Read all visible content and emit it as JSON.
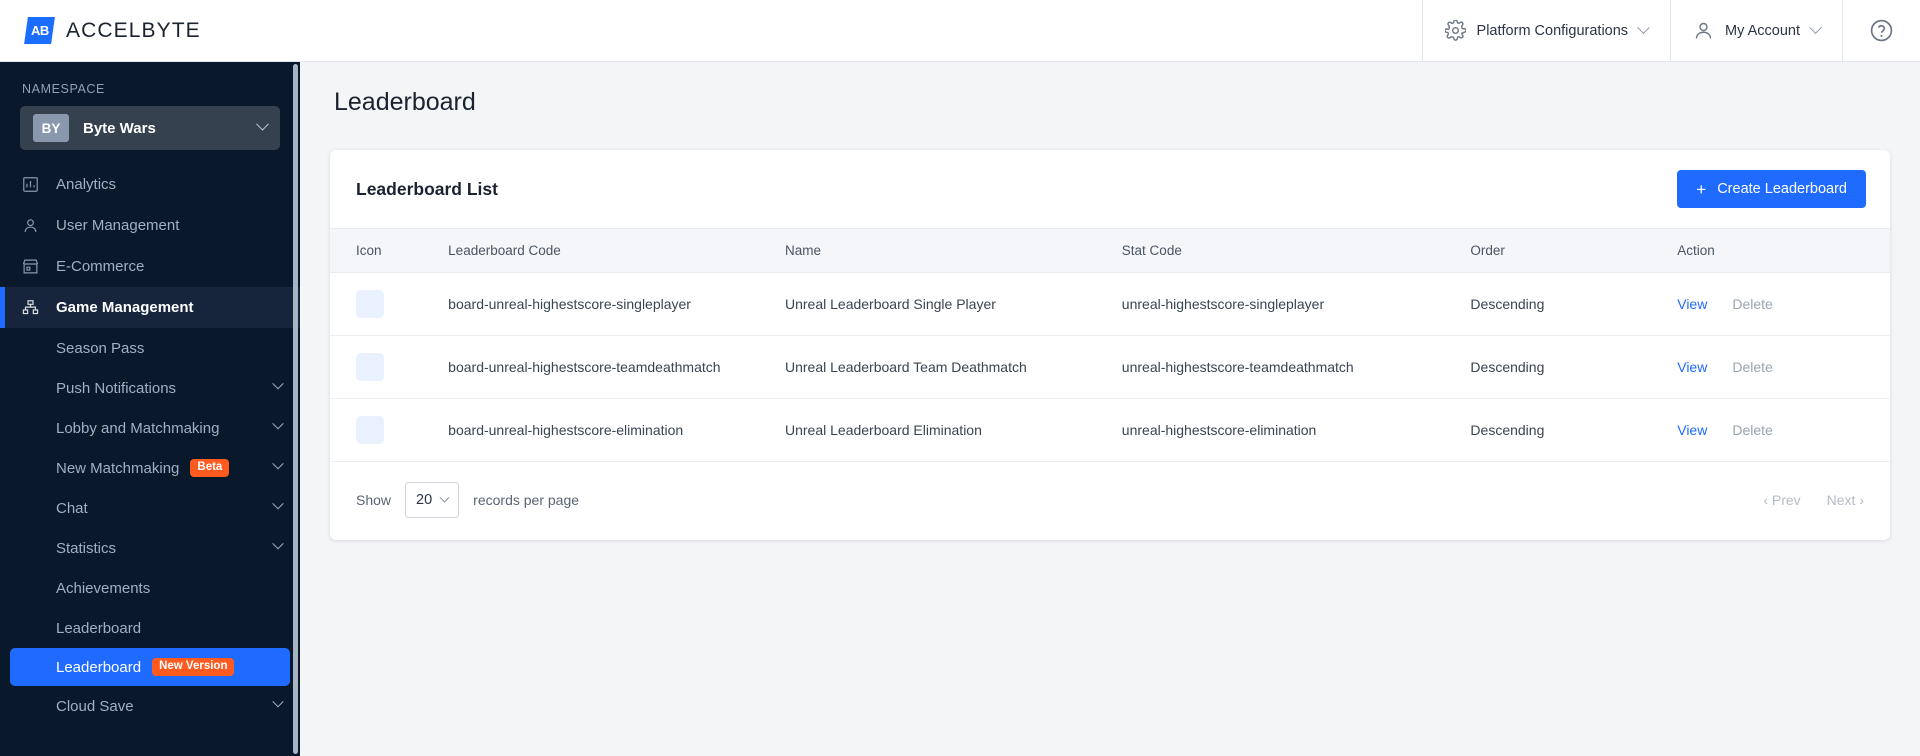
{
  "header": {
    "brand_mark": "AB",
    "brand_name": "ACCELBYTE",
    "platform_config": "Platform Configurations",
    "my_account": "My Account",
    "help": "?"
  },
  "sidebar": {
    "namespace_label": "NAMESPACE",
    "namespace": {
      "badge": "BY",
      "name": "Byte Wars"
    },
    "nav": [
      {
        "label": "Analytics",
        "icon": "bar-chart-icon",
        "active": false
      },
      {
        "label": "User Management",
        "icon": "user-icon",
        "active": false
      },
      {
        "label": "E-Commerce",
        "icon": "store-icon",
        "active": false
      },
      {
        "label": "Game Management",
        "icon": "sitemap-icon",
        "active": true
      }
    ],
    "sub_items": [
      {
        "label": "Season Pass",
        "chevron": false,
        "tag": "",
        "selected": false
      },
      {
        "label": "Push Notifications",
        "chevron": true,
        "tag": "",
        "selected": false
      },
      {
        "label": "Lobby and Matchmaking",
        "chevron": true,
        "tag": "",
        "selected": false
      },
      {
        "label": "New Matchmaking",
        "chevron": true,
        "tag": "Beta",
        "selected": false
      },
      {
        "label": "Chat",
        "chevron": true,
        "tag": "",
        "selected": false
      },
      {
        "label": "Statistics",
        "chevron": true,
        "tag": "",
        "selected": false
      },
      {
        "label": "Achievements",
        "chevron": false,
        "tag": "",
        "selected": false
      },
      {
        "label": "Leaderboard",
        "chevron": false,
        "tag": "",
        "selected": false
      },
      {
        "label": "Leaderboard",
        "chevron": false,
        "tag": "New Version",
        "selected": true
      },
      {
        "label": "Cloud Save",
        "chevron": true,
        "tag": "",
        "selected": false
      }
    ]
  },
  "main": {
    "page_title": "Leaderboard",
    "card_title": "Leaderboard List",
    "create_button": "Create Leaderboard",
    "create_button_plus": "+",
    "columns": [
      "Icon",
      "Leaderboard Code",
      "Name",
      "Stat Code",
      "Order",
      "Action"
    ],
    "rows": [
      {
        "code": "board-unreal-highestscore-singleplayer",
        "name": "Unreal Leaderboard Single Player",
        "stat_code": "unreal-highestscore-singleplayer",
        "order": "Descending",
        "view": "View",
        "delete": "Delete"
      },
      {
        "code": "board-unreal-highestscore-teamdeathmatch",
        "name": "Unreal Leaderboard Team Deathmatch",
        "stat_code": "unreal-highestscore-teamdeathmatch",
        "order": "Descending",
        "view": "View",
        "delete": "Delete"
      },
      {
        "code": "board-unreal-highestscore-elimination",
        "name": "Unreal Leaderboard Elimination",
        "stat_code": "unreal-highestscore-elimination",
        "order": "Descending",
        "view": "View",
        "delete": "Delete"
      }
    ],
    "footer": {
      "show_label": "Show",
      "page_size": "20",
      "records_label": "records per page",
      "prev": "‹ Prev",
      "next": "Next ›"
    }
  },
  "colors": {
    "accent": "#1f6bff",
    "sidebar_bg": "#0a182b",
    "tag_orange": "#ff5a1f",
    "page_bg": "#f4f5f7"
  }
}
